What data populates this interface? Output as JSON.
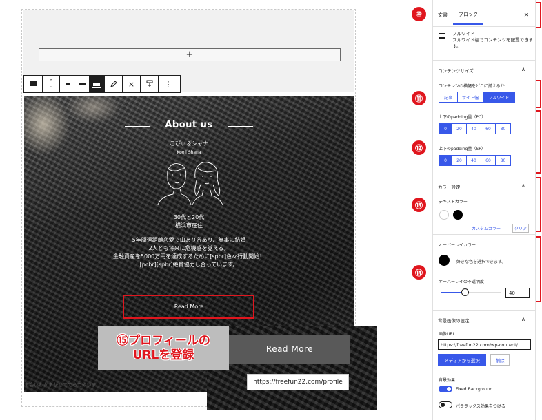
{
  "editor": {
    "appender_symbol": "+",
    "toolbar": {
      "icons": [
        "cover-block-icon",
        "move-arrows-icon",
        "align-center-icon",
        "align-wide-icon",
        "align-full-icon",
        "edit-pencil-icon",
        "clear-x-icon",
        "format-icon",
        "more-options-icon"
      ],
      "close_symbol": "×",
      "more_symbol": "⋮"
    },
    "cover": {
      "title": "About us",
      "names_jp": "こびぃ＆シャナ",
      "names_en": "Kooli Shana",
      "age": "30代と20代",
      "location": "横浜市在住",
      "bio_lines": [
        "5年間遠距離恋愛で山あり谷あり、無事に結婚",
        "2人とも将来に危機感を覚える。",
        "金融資産を5000万円を達成するために[spbr]色々行動開始！",
        "[pcbr][spbr]絶賛協力し合っています。"
      ],
      "read_more": "Read More"
    },
    "caption_text": "ま会いわかまかせてでらでやいま"
  },
  "callout": {
    "label_line1": "⑮プロフィールの",
    "label_line2": "URLを登録",
    "zoom_button": "Read More",
    "zoom_url": "https://freefun22.com/profile"
  },
  "sidebar": {
    "tabs": {
      "document": "文書",
      "block": "ブロック",
      "close": "×"
    },
    "block_info": {
      "title": "フルワイド",
      "desc": "フルワイド幅でコンテンツを配置できます。"
    },
    "content_size": {
      "title": "コンテンツサイズ",
      "question": "コンテンツの横幅をどこに揃えるか",
      "options": [
        "記事",
        "サイト幅",
        "フルワイド"
      ],
      "selected": "フルワイド"
    },
    "padding": {
      "pc_label": "上下のpadding量（PC）",
      "sp_label": "上下のpadding量（SP）",
      "options": [
        "0",
        "20",
        "40",
        "60",
        "80"
      ],
      "selected": "0"
    },
    "color": {
      "title": "カラー設定",
      "text_color_label": "テキストカラー",
      "swatch_white": "#ffffff",
      "swatch_black": "#000000",
      "custom_color": "カスタムカラー",
      "clear": "クリア"
    },
    "overlay": {
      "title": "オーバーレイカラー",
      "hint": "好きな色を選択できます。",
      "color": "#000000",
      "opacity_label": "オーバーレイの不透明度",
      "opacity_value": "40",
      "opacity_fraction": 0.4
    },
    "background": {
      "title": "背景画像の設定",
      "image_url_label": "画像URL",
      "image_url": "https://freefun22.com/wp-content/",
      "media_button": "メディアから選択",
      "delete_button": "削除",
      "effect_label": "背景効果",
      "fixed_label": "Fixed Background",
      "fixed_on": true,
      "parallax_label": "パララックス効果をつける",
      "parallax_on": false
    },
    "chevron_up": "∧"
  },
  "annotations": {
    "n10": "⑩",
    "n11": "⑪",
    "n12": "⑫",
    "n13": "⑬",
    "n14": "⑭",
    "accent_red": "#e0161e",
    "accent_blue": "#3858e9"
  }
}
